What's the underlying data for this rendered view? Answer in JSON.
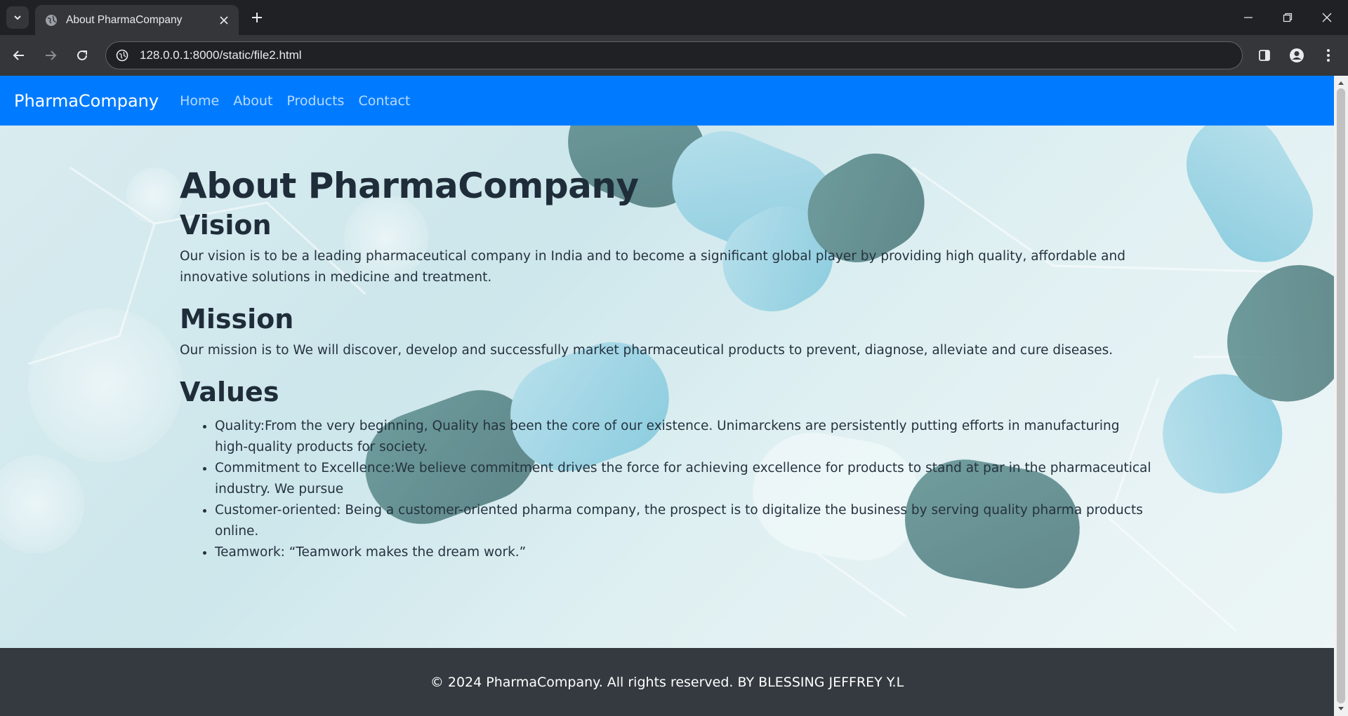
{
  "browser": {
    "tab_title": "About PharmaCompany",
    "url": "128.0.0.1:8000/static/file2.html"
  },
  "site": {
    "brand": "PharmaCompany",
    "nav": [
      "Home",
      "About",
      "Products",
      "Contact"
    ]
  },
  "page": {
    "heading": "About PharmaCompany",
    "vision_title": "Vision",
    "vision_text": "Our vision is to be a leading pharmaceutical company in India and to become a significant global player by providing high quality, affordable and innovative solutions in medicine and treatment.",
    "mission_title": "Mission",
    "mission_text": "Our mission is to We will discover, develop and successfully market pharmaceutical products to prevent, diagnose, alleviate and cure diseases.",
    "values_title": "Values",
    "values": [
      "Quality:From the very beginning, Quality has been the core of our existence. Unimarckens are persistently putting efforts in manufacturing high-quality products for society.",
      "Commitment to Excellence:We believe commitment drives the force for achieving excellence for products to stand at par in the pharmaceutical industry. We pursue",
      "Customer-oriented: Being a customer-oriented pharma company, the prospect is to digitalize the business by serving quality pharma products online.",
      "Teamwork: “Teamwork makes the dream work.”"
    ]
  },
  "footer": {
    "text": "© 2024 PharmaCompany. All rights reserved. BY BLESSING JEFFREY Y.L"
  },
  "colors": {
    "navbar": "#007bff",
    "footer": "#343a40",
    "chrome_dark": "#202124",
    "chrome_toolbar": "#35363a"
  }
}
